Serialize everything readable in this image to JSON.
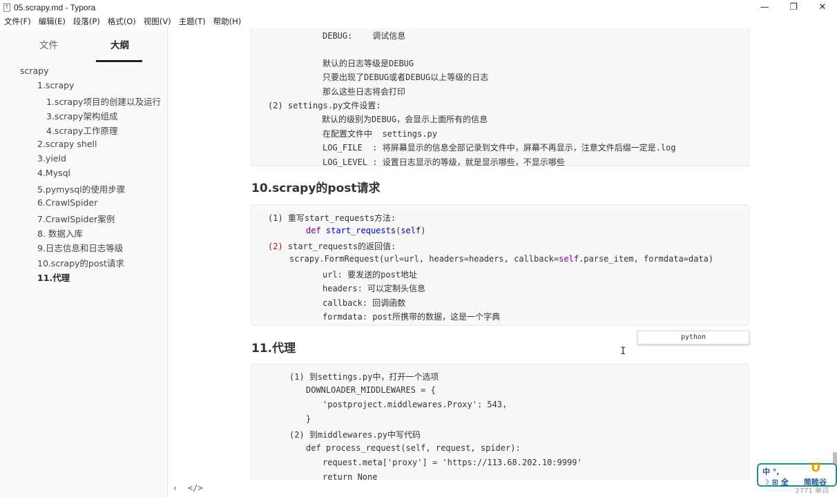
{
  "window": {
    "title": "05.scrapy.md - Typora",
    "app_icon": "T",
    "controls": {
      "minimize": "—",
      "maximize": "❐",
      "close": "✕"
    }
  },
  "menu": [
    "文件(F)",
    "编辑(E)",
    "段落(P)",
    "格式(O)",
    "视图(V)",
    "主题(T)",
    "帮助(H)"
  ],
  "sidebar": {
    "tab_files": "文件",
    "tab_outline": "大纲",
    "outline": [
      "scrapy",
      "1.scrapy",
      "1.scrapy项目的创建以及运行",
      "3.scrapy架构组成",
      "4.scrapy工作原理",
      "2.scrapy shell",
      "3.yield",
      "4.Mysql",
      "5.pymysql的使用步骤",
      "6.CrawlSpider",
      "7.CrawlSpider案例",
      "8. 数据入库",
      "9.日志信息和日志等级",
      "10.scrapy的post请求",
      "11.代理"
    ]
  },
  "doc": {
    "block1": [
      "DEBUG:    调试信息",
      "默认的日志等级是DEBUG",
      "只要出现了DEBUG或者DEBUG以上等级的日志",
      "那么这些日志将会打印",
      "(2) settings.py文件设置:",
      "默认的级别为DEBUG，会显示上面所有的信息",
      "在配置文件中  settings.py",
      "LOG_FILE  : 将屏幕显示的信息全部记录到文件中，屏幕不再显示，注意文件后缀一定是.log",
      "LOG_LEVEL : 设置日志显示的等级，就是显示哪些，不显示哪些"
    ],
    "heading10": "10.scrapy的post请求",
    "block2": {
      "l1": "(1) 重写start_requests方法:",
      "l2_kw": "def",
      "l2_fn": "start_requests",
      "l2_paren_open": "(",
      "l2_self": "self",
      "l2_paren_close": ")",
      "l3_num": "(2)",
      "l3_rest": " start_requests的返回值:",
      "l4_a": "scrapy.FormRequest(url=url, headers=headers, callback=",
      "l4_self": "self",
      "l4_b": ".parse_item, formdata=data)",
      "l5": "url: 要发送的post地址",
      "l6": "headers: 可以定制头信息",
      "l7": "callback: 回调函数",
      "l8": "formdata: post所携带的数据，这是一个字典"
    },
    "lang_popup": "python",
    "heading11": "11.代理",
    "block3": [
      "(1) 到settings.py中，打开一个选项",
      "DOWNLOADER_MIDDLEWARES = {",
      "'postproject.middlewares.Proxy': 543,",
      "}",
      "(2) 到middlewares.py中写代码",
      "def process_request(self, request, spider):",
      "request.meta['proxy'] = 'https://113.68.202.10:9999'",
      "return None"
    ]
  },
  "status": {
    "back": "‹",
    "source_toggle": "</>",
    "word_count": "2771 单词"
  },
  "ime": {
    "line1": "中 °,",
    "line2": "☽ ⊞ 全",
    "logo": "U",
    "brand": "简睦谷"
  }
}
